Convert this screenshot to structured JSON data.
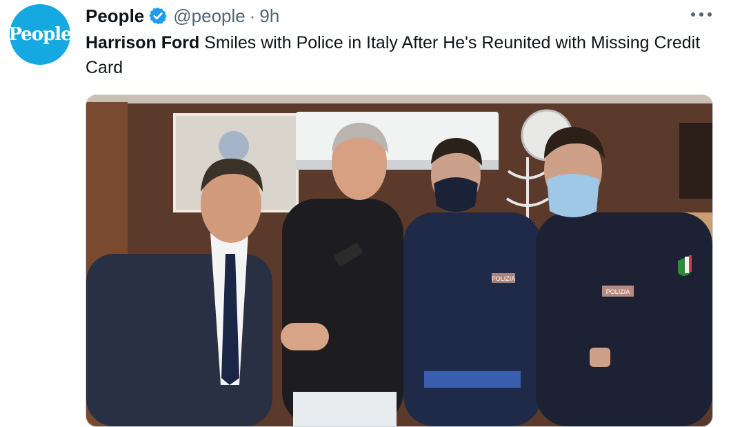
{
  "account": {
    "avatar_text": "People",
    "name": "People",
    "handle": "@people",
    "separator": "·",
    "time": "9h"
  },
  "tweet": {
    "bold_name": "Harrison Ford",
    "text_rest": " Smiles with Police in Italy After He's Reunited with Missing Credit Card"
  },
  "media": {
    "badge_text": "POLIZIA"
  },
  "colors": {
    "brand_blue": "#16a8e0",
    "verified_blue": "#1d9bf0",
    "text": "#0f1419",
    "muted": "#536471"
  },
  "icons": {
    "verified": "verified-badge-icon",
    "more": "more-dots-icon"
  }
}
